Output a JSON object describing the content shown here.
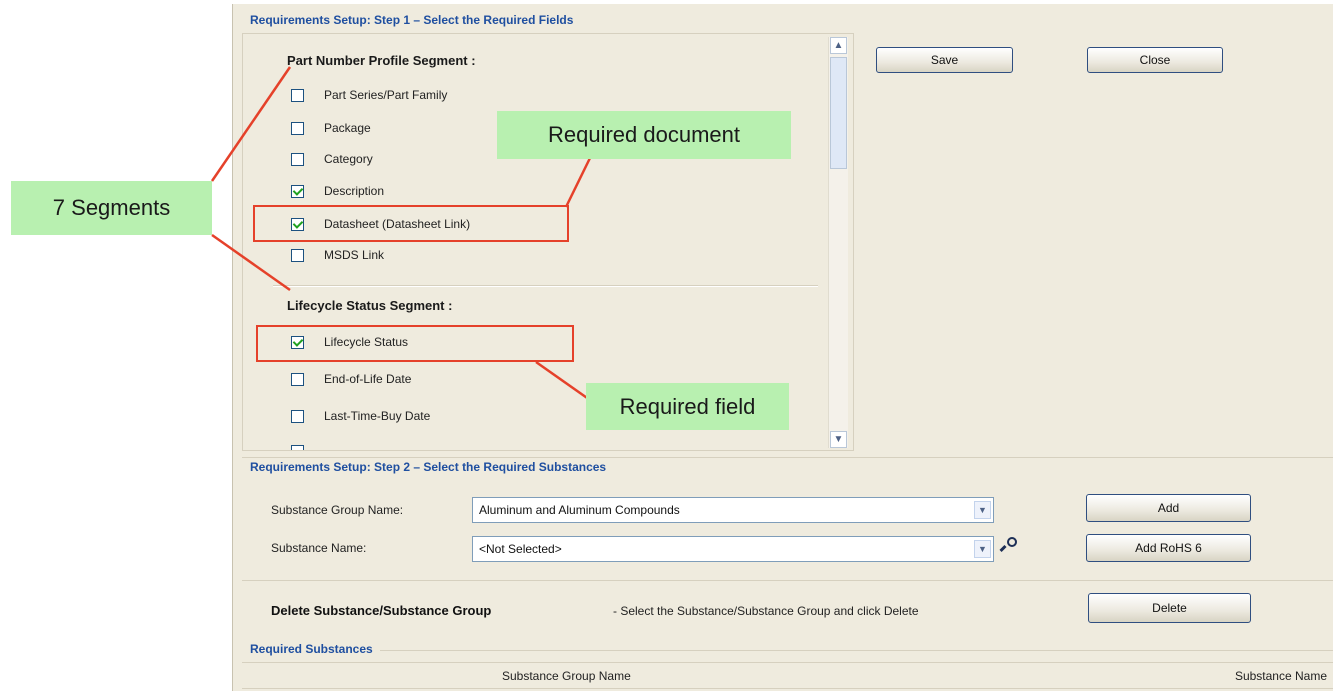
{
  "step1": {
    "title": "Requirements Setup: Step 1 – Select the Required Fields",
    "segments": [
      {
        "title": "Part Number Profile Segment :",
        "items": [
          {
            "label": "Part Series/Part Family",
            "checked": false
          },
          {
            "label": "Package",
            "checked": false
          },
          {
            "label": "Category",
            "checked": false
          },
          {
            "label": "Description",
            "checked": true
          },
          {
            "label": "Datasheet (Datasheet Link)",
            "checked": true
          },
          {
            "label": "MSDS Link",
            "checked": false
          }
        ]
      },
      {
        "title": "Lifecycle Status Segment :",
        "items": [
          {
            "label": "Lifecycle Status",
            "checked": true
          },
          {
            "label": "End-of-Life Date",
            "checked": false
          },
          {
            "label": "Last-Time-Buy Date",
            "checked": false
          }
        ]
      }
    ],
    "save_label": "Save",
    "close_label": "Close"
  },
  "step2": {
    "title": "Requirements Setup: Step 2 – Select the Required Substances",
    "group_label": "Substance Group Name:",
    "group_value": "Aluminum and Aluminum Compounds",
    "name_label": "Substance Name:",
    "name_value": "<Not Selected>",
    "add_label": "Add",
    "add_rohs_label": "Add RoHS 6"
  },
  "delete_section": {
    "title": "Delete Substance/Substance Group",
    "hint": "- Select the Substance/Substance Group and click Delete",
    "delete_label": "Delete"
  },
  "required_substances": {
    "title": "Required Substances",
    "columns": [
      "Substance Group Name",
      "Substance Name"
    ]
  },
  "annotations": {
    "segments": "7 Segments",
    "required_document": "Required document",
    "required_field": "Required field"
  },
  "colors": {
    "accent_title": "#1f4fa0",
    "callout_bg": "#b8f0b0",
    "annotation_red": "#e5412a"
  }
}
